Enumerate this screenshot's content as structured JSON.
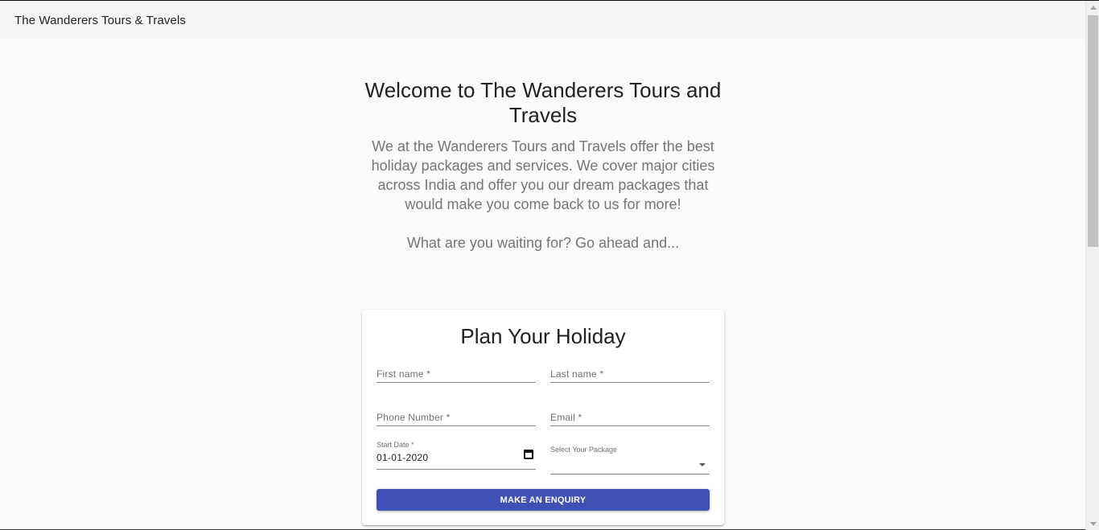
{
  "appbar": {
    "title": "The Wanderers Tours & Travels"
  },
  "hero": {
    "title": "Welcome to The Wanderers Tours and Travels",
    "description": "We at the Wanderers Tours and Travels offer the best holiday packages and services. We cover major cities across India and offer you our dream packages that would make you come back to us for more!",
    "cta": "What are you waiting for? Go ahead and..."
  },
  "form": {
    "title": "Plan Your Holiday",
    "first_name_label": "First name *",
    "last_name_label": "Last name *",
    "phone_label": "Phone Number *",
    "email_label": "Email *",
    "start_date_label": "Start Date *",
    "start_date_value": "01-01-2020",
    "package_label": "Select Your Package",
    "submit_label": "MAKE AN ENQUIRY"
  },
  "colors": {
    "primary": "#3f51b5",
    "background": "#fafafa"
  },
  "icons": {
    "date": "calendar-icon",
    "select": "dropdown-arrow-icon"
  }
}
